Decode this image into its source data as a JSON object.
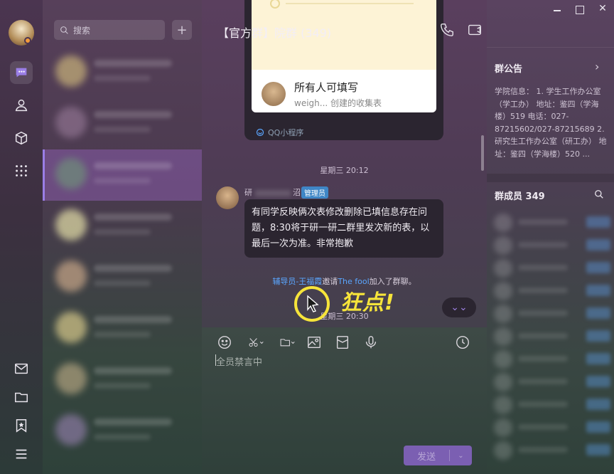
{
  "app": {
    "accent": "#7b5fb2",
    "highlight": "#f6e43a"
  },
  "rail": {
    "items": [
      {
        "icon": "chat-icon",
        "active": true
      },
      {
        "icon": "contacts-icon"
      },
      {
        "icon": "cube-icon"
      },
      {
        "icon": "apps-grid-icon"
      },
      {
        "icon": "mail-icon"
      },
      {
        "icon": "folder-icon"
      },
      {
        "icon": "bookmark-star-icon"
      },
      {
        "icon": "menu-icon"
      }
    ]
  },
  "search": {
    "placeholder": "搜索"
  },
  "chat": {
    "title": "【官方群】院群 (349)",
    "card": {
      "title": "所有人可填写",
      "subtitle": "weigh... 创建的收集表",
      "source": "QQ小程序"
    },
    "timestamp1": "星期三 20:12",
    "message": {
      "sender": "研",
      "sender_suffix": "沼",
      "badge": "管理员",
      "text": "有同学反映俩次表修改删除已填信息存在问题，8:30将于研一研二群里发次新的表，以最后一次为准。非常抱歉"
    },
    "system": {
      "inviter": "辅导员-王福霞",
      "verb": "邀请",
      "invitee": "The fool",
      "suffix": "加入了群聊。"
    },
    "timestamp2": "星期三 20:30",
    "overlay_text": "狂点!"
  },
  "input": {
    "muted_text": "全员禁言中",
    "send_label": "发送"
  },
  "right": {
    "notice_title": "群公告",
    "notice_body": "学院信息： 1. 学生工作办公室（学工办） 地址：鉴四（学海楼）519 电话：027-87215602/027-87215689 2. 研究生工作办公室（研工办） 地址：鉴四（学海楼）520 ...",
    "members_title": "群成员 349"
  }
}
